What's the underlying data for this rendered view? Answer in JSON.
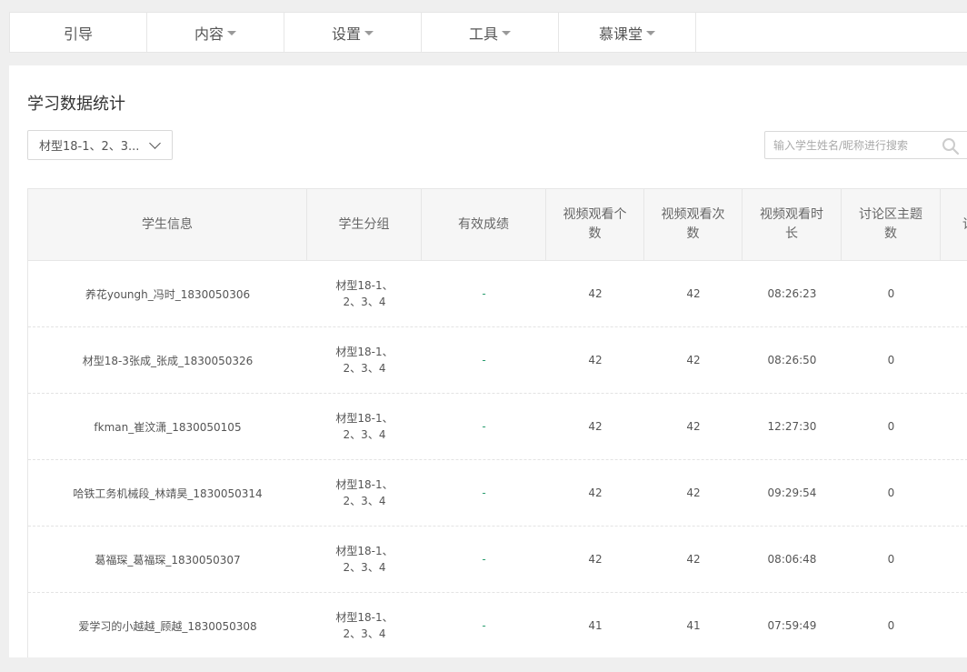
{
  "nav": {
    "items": [
      {
        "label": "引导",
        "dropdown": false
      },
      {
        "label": "内容",
        "dropdown": true
      },
      {
        "label": "设置",
        "dropdown": true
      },
      {
        "label": "工具",
        "dropdown": true
      },
      {
        "label": "慕课堂",
        "dropdown": true
      }
    ]
  },
  "page": {
    "title": "学习数据统计",
    "class_select_value": "材型18-1、2、3...",
    "search_placeholder": "输入学生姓名/昵称进行搜索"
  },
  "table": {
    "headers": [
      "学生信息",
      "学生分组",
      "有效成绩",
      "视频观看个数",
      "视频观看次数",
      "视频观看时长",
      "讨论区主题数",
      "讨"
    ],
    "rows": [
      {
        "student": "养花youngh_冯时_1830050306",
        "group": "材型18-1、2、3、4",
        "score": "-",
        "video_count": "42",
        "video_views": "42",
        "video_time": "08:26:23",
        "topics": "0"
      },
      {
        "student": "材型18-3张成_张成_1830050326",
        "group": "材型18-1、2、3、4",
        "score": "-",
        "video_count": "42",
        "video_views": "42",
        "video_time": "08:26:50",
        "topics": "0"
      },
      {
        "student": "fkman_崔汶潇_1830050105",
        "group": "材型18-1、2、3、4",
        "score": "-",
        "video_count": "42",
        "video_views": "42",
        "video_time": "12:27:30",
        "topics": "0"
      },
      {
        "student": "哈铁工务机械段_林靖昊_1830050314",
        "group": "材型18-1、2、3、4",
        "score": "-",
        "video_count": "42",
        "video_views": "42",
        "video_time": "09:29:54",
        "topics": "0"
      },
      {
        "student": "葛福琛_葛福琛_1830050307",
        "group": "材型18-1、2、3、4",
        "score": "-",
        "video_count": "42",
        "video_views": "42",
        "video_time": "08:06:48",
        "topics": "0"
      },
      {
        "student": "爱学习的小越越_顾越_1830050308",
        "group": "材型18-1、2、3、4",
        "score": "-",
        "video_count": "41",
        "video_views": "41",
        "video_time": "07:59:49",
        "topics": "0"
      }
    ]
  }
}
